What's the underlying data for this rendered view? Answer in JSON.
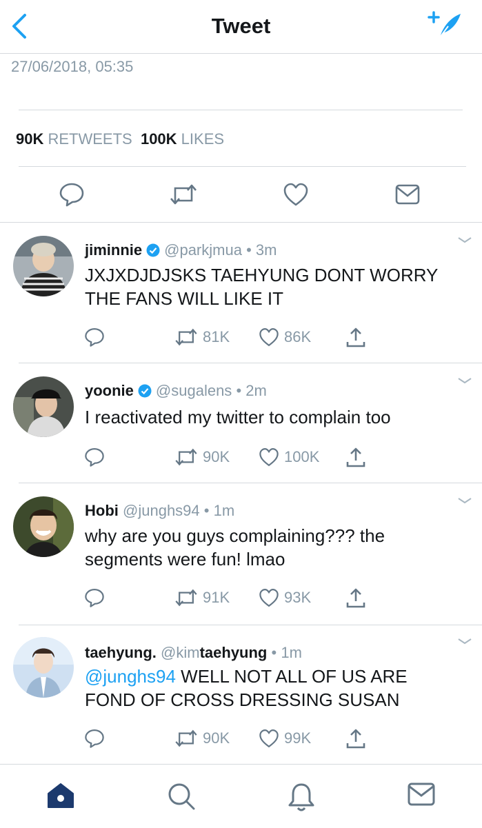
{
  "header": {
    "title": "Tweet",
    "back_icon": "back-chevron-icon",
    "compose_icon": "compose-feather-icon"
  },
  "tweet": {
    "timestamp": "27/06/2018, 05:35",
    "retweets_count": "90K",
    "retweets_label": "RETWEETS",
    "likes_count": "100K",
    "likes_label": "LIKES"
  },
  "replies": [
    {
      "name": "jiminnie",
      "verified": true,
      "handle": "@parkjmua",
      "time": "3m",
      "text": "JXJXDJDJSKS TAEHYUNG DONT WORRY THE FANS WILL LIKE IT",
      "retweets": "81K",
      "likes": "86K"
    },
    {
      "name": "yoonie",
      "verified": true,
      "handle": "@sugalens",
      "time": "2m",
      "text": "I reactivated my twitter to complain too",
      "retweets": "90K",
      "likes": "100K"
    },
    {
      "name": "Hobi",
      "verified": false,
      "handle": "@junghs94",
      "time": "1m",
      "text": "why are you guys complaining??? the segments were fun! lmao",
      "retweets": "91K",
      "likes": "93K"
    },
    {
      "name": "taehyung.",
      "verified": false,
      "handle_prefix": "@kim",
      "handle_bold": "taehyung",
      "time": "1m",
      "mention": "@junghs94",
      "text": "WELL NOT ALL OF US ARE FOND OF CROSS DRESSING SUSAN",
      "retweets": "90K",
      "likes": "99K"
    }
  ],
  "meta_separator": "•",
  "colors": {
    "accent": "#1da1f2",
    "muted": "#8899a6",
    "nav_active": "#1c3a6e",
    "icon": "#657786"
  }
}
